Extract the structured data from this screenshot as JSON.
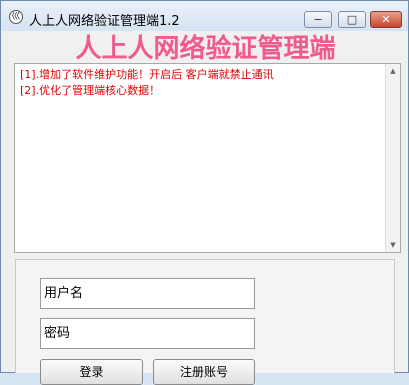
{
  "window": {
    "title": "人上人网络验证管理端1.2",
    "app_icon_glyph": "巛",
    "controls": {
      "minimize": "−",
      "maximize": "□",
      "close": "✕"
    }
  },
  "headline": "人上人网络验证管理端",
  "log": {
    "lines": [
      "[1].增加了软件维护功能！开启后 客户端就禁止通讯",
      "[2].优化了管理端核心数据！"
    ],
    "text_color": "#e00000"
  },
  "login": {
    "username_value": "用户名",
    "password_value": "密码",
    "login_label": "登录",
    "register_label": "注册账号"
  },
  "colors": {
    "headline": "#f05a8c",
    "close_button": "#c6452d"
  }
}
